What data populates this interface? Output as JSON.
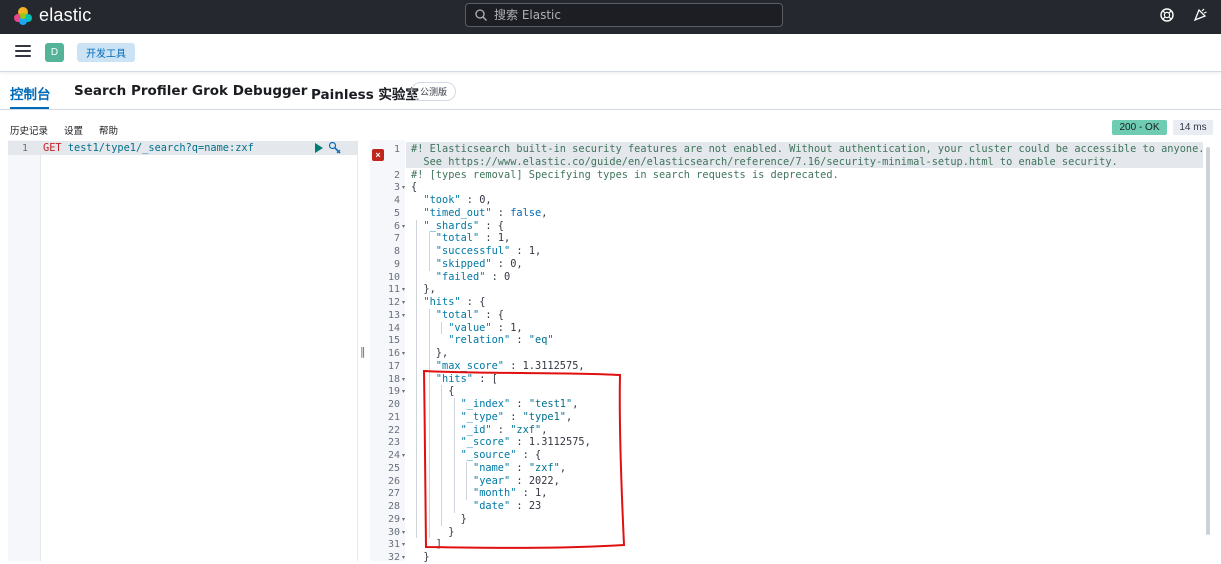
{
  "header": {
    "logo_text": "elastic",
    "search_placeholder": "搜索 Elastic",
    "icons": [
      "elastic-logo-icon",
      "search-icon",
      "help-icon",
      "news-icon"
    ]
  },
  "subbar": {
    "space_initial": "D",
    "breadcrumb": "开发工具"
  },
  "tabs": [
    {
      "label": "控制台",
      "active": true
    },
    {
      "label": "Search Profiler",
      "active": false
    },
    {
      "label": "Grok Debugger",
      "active": false
    },
    {
      "label": "Painless 实验室",
      "active": false
    }
  ],
  "beta_badge": "公测版",
  "console_toolbar": {
    "history": "历史记录",
    "settings": "设置",
    "help": "帮助",
    "status": "200 - OK",
    "duration": "14 ms"
  },
  "request": {
    "line_number": "1",
    "method": "GET",
    "url": "test1/type1/_search?q=name:zxf"
  },
  "response_lines": [
    {
      "n": "1",
      "fold": false,
      "indent": 0,
      "parts": [
        [
          "c-comment",
          "#! Elasticsearch built-in security features are not enabled. Without authentication, your cluster could be accessible to anyone."
        ]
      ]
    },
    {
      "n": "",
      "fold": false,
      "indent": 0,
      "parts": [
        [
          "c-comment",
          "  See https://www.elastic.co/guide/en/elasticsearch/reference/7.16/security-minimal-setup.html to enable security."
        ]
      ]
    },
    {
      "n": "2",
      "fold": false,
      "indent": 0,
      "parts": [
        [
          "c-comment",
          "#! [types removal] Specifying types in search requests is deprecated."
        ]
      ]
    },
    {
      "n": "3",
      "fold": true,
      "indent": 0,
      "parts": [
        [
          "c-punc",
          "{"
        ]
      ]
    },
    {
      "n": "4",
      "fold": false,
      "indent": 1,
      "parts": [
        [
          "c-key",
          "\"took\""
        ],
        [
          "c-punc",
          " : "
        ],
        [
          "c-num",
          "0"
        ],
        [
          "c-punc",
          ","
        ]
      ]
    },
    {
      "n": "5",
      "fold": false,
      "indent": 1,
      "parts": [
        [
          "c-key",
          "\"timed_out\""
        ],
        [
          "c-punc",
          " : "
        ],
        [
          "c-bool",
          "false"
        ],
        [
          "c-punc",
          ","
        ]
      ]
    },
    {
      "n": "6",
      "fold": true,
      "indent": 1,
      "parts": [
        [
          "c-key",
          "\"_shards\""
        ],
        [
          "c-punc",
          " : {"
        ]
      ]
    },
    {
      "n": "7",
      "fold": false,
      "indent": 2,
      "parts": [
        [
          "c-key",
          "\"total\""
        ],
        [
          "c-punc",
          " : "
        ],
        [
          "c-num",
          "1"
        ],
        [
          "c-punc",
          ","
        ]
      ]
    },
    {
      "n": "8",
      "fold": false,
      "indent": 2,
      "parts": [
        [
          "c-key",
          "\"successful\""
        ],
        [
          "c-punc",
          " : "
        ],
        [
          "c-num",
          "1"
        ],
        [
          "c-punc",
          ","
        ]
      ]
    },
    {
      "n": "9",
      "fold": false,
      "indent": 2,
      "parts": [
        [
          "c-key",
          "\"skipped\""
        ],
        [
          "c-punc",
          " : "
        ],
        [
          "c-num",
          "0"
        ],
        [
          "c-punc",
          ","
        ]
      ]
    },
    {
      "n": "10",
      "fold": false,
      "indent": 2,
      "parts": [
        [
          "c-key",
          "\"failed\""
        ],
        [
          "c-punc",
          " : "
        ],
        [
          "c-num",
          "0"
        ]
      ]
    },
    {
      "n": "11",
      "fold": true,
      "indent": 1,
      "parts": [
        [
          "c-punc",
          "},"
        ]
      ]
    },
    {
      "n": "12",
      "fold": true,
      "indent": 1,
      "parts": [
        [
          "c-key",
          "\"hits\""
        ],
        [
          "c-punc",
          " : {"
        ]
      ]
    },
    {
      "n": "13",
      "fold": true,
      "indent": 2,
      "parts": [
        [
          "c-key",
          "\"total\""
        ],
        [
          "c-punc",
          " : {"
        ]
      ]
    },
    {
      "n": "14",
      "fold": false,
      "indent": 3,
      "parts": [
        [
          "c-key",
          "\"value\""
        ],
        [
          "c-punc",
          " : "
        ],
        [
          "c-num",
          "1"
        ],
        [
          "c-punc",
          ","
        ]
      ]
    },
    {
      "n": "15",
      "fold": false,
      "indent": 3,
      "parts": [
        [
          "c-key",
          "\"relation\""
        ],
        [
          "c-punc",
          " : "
        ],
        [
          "c-str",
          "\"eq\""
        ]
      ]
    },
    {
      "n": "16",
      "fold": true,
      "indent": 2,
      "parts": [
        [
          "c-punc",
          "},"
        ]
      ]
    },
    {
      "n": "17",
      "fold": false,
      "indent": 2,
      "parts": [
        [
          "c-key",
          "\"max_score\""
        ],
        [
          "c-punc",
          " : "
        ],
        [
          "c-num",
          "1.3112575"
        ],
        [
          "c-punc",
          ","
        ]
      ]
    },
    {
      "n": "18",
      "fold": true,
      "indent": 2,
      "parts": [
        [
          "c-key",
          "\"hits\""
        ],
        [
          "c-punc",
          " : ["
        ]
      ]
    },
    {
      "n": "19",
      "fold": true,
      "indent": 3,
      "parts": [
        [
          "c-punc",
          "{"
        ]
      ]
    },
    {
      "n": "20",
      "fold": false,
      "indent": 4,
      "parts": [
        [
          "c-key",
          "\"_index\""
        ],
        [
          "c-punc",
          " : "
        ],
        [
          "c-str",
          "\"test1\""
        ],
        [
          "c-punc",
          ","
        ]
      ]
    },
    {
      "n": "21",
      "fold": false,
      "indent": 4,
      "parts": [
        [
          "c-key",
          "\"_type\""
        ],
        [
          "c-punc",
          " : "
        ],
        [
          "c-str",
          "\"type1\""
        ],
        [
          "c-punc",
          ","
        ]
      ]
    },
    {
      "n": "22",
      "fold": false,
      "indent": 4,
      "parts": [
        [
          "c-key",
          "\"_id\""
        ],
        [
          "c-punc",
          " : "
        ],
        [
          "c-str",
          "\"zxf\""
        ],
        [
          "c-punc",
          ","
        ]
      ]
    },
    {
      "n": "23",
      "fold": false,
      "indent": 4,
      "parts": [
        [
          "c-key",
          "\"_score\""
        ],
        [
          "c-punc",
          " : "
        ],
        [
          "c-num",
          "1.3112575"
        ],
        [
          "c-punc",
          ","
        ]
      ]
    },
    {
      "n": "24",
      "fold": true,
      "indent": 4,
      "parts": [
        [
          "c-key",
          "\"_source\""
        ],
        [
          "c-punc",
          " : {"
        ]
      ]
    },
    {
      "n": "25",
      "fold": false,
      "indent": 5,
      "parts": [
        [
          "c-key",
          "\"name\""
        ],
        [
          "c-punc",
          " : "
        ],
        [
          "c-str",
          "\"zxf\""
        ],
        [
          "c-punc",
          ","
        ]
      ]
    },
    {
      "n": "26",
      "fold": false,
      "indent": 5,
      "parts": [
        [
          "c-key",
          "\"year\""
        ],
        [
          "c-punc",
          " : "
        ],
        [
          "c-num",
          "2022"
        ],
        [
          "c-punc",
          ","
        ]
      ]
    },
    {
      "n": "27",
      "fold": false,
      "indent": 5,
      "parts": [
        [
          "c-key",
          "\"month\""
        ],
        [
          "c-punc",
          " : "
        ],
        [
          "c-num",
          "1"
        ],
        [
          "c-punc",
          ","
        ]
      ]
    },
    {
      "n": "28",
      "fold": false,
      "indent": 5,
      "parts": [
        [
          "c-key",
          "\"date\""
        ],
        [
          "c-punc",
          " : "
        ],
        [
          "c-num",
          "23"
        ]
      ]
    },
    {
      "n": "29",
      "fold": true,
      "indent": 4,
      "parts": [
        [
          "c-punc",
          "}"
        ]
      ]
    },
    {
      "n": "30",
      "fold": true,
      "indent": 3,
      "parts": [
        [
          "c-punc",
          "}"
        ]
      ]
    },
    {
      "n": "31",
      "fold": true,
      "indent": 2,
      "parts": [
        [
          "c-punc",
          "]"
        ]
      ]
    },
    {
      "n": "32",
      "fold": true,
      "indent": 1,
      "parts": [
        [
          "c-punc",
          "}"
        ]
      ]
    }
  ],
  "colors": {
    "header_bg": "#25282f",
    "accent": "#006bb8",
    "status_ok": "#6dccb1",
    "annotation_red": "#e01010"
  }
}
